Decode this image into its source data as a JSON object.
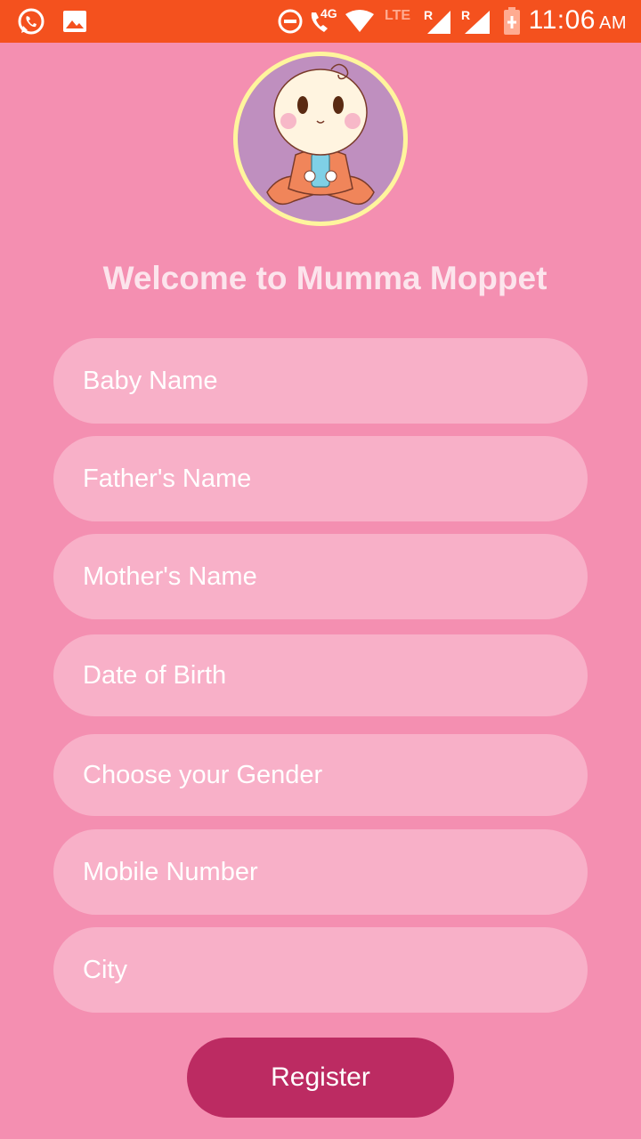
{
  "status_bar": {
    "time": "11:06",
    "ampm": "AM",
    "network": "4G",
    "lte": "LTE",
    "roaming1": "R",
    "roaming2": "R",
    "icons": [
      "whatsapp-icon",
      "image-icon",
      "do-not-disturb-icon",
      "wifi-call-icon",
      "wifi-icon",
      "signal-icon",
      "signal-icon",
      "battery-charging-icon"
    ],
    "color": "#f4511e"
  },
  "app": {
    "logo": "baby-logo",
    "title": "Welcome to Mumma Moppet"
  },
  "form": {
    "baby_name_placeholder": "Baby Name",
    "father_name_placeholder": "Father's Name",
    "mother_name_placeholder": "Mother's Name",
    "dob_placeholder": "Date of Birth",
    "gender_placeholder": "Choose your Gender",
    "mobile_placeholder": "Mobile Number",
    "city_placeholder": "City",
    "register_label": "Register"
  },
  "colors": {
    "background": "#f48fb1",
    "field": "#f8b0c8",
    "button": "#bc2b62",
    "title": "#fce4ec"
  }
}
